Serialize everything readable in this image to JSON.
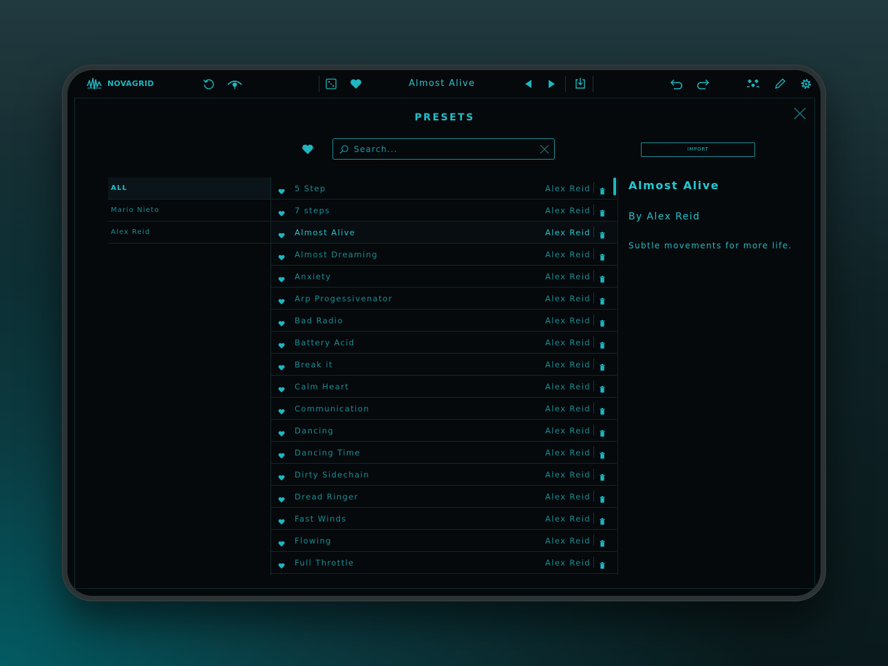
{
  "colors": {
    "accent": "#1fb6c0",
    "background": "#05090b",
    "frame": "#2c3335"
  },
  "topbar": {
    "logo_text": "NOVAGRID",
    "current_preset": "Almost Alive",
    "icons": [
      "logo-icon",
      "reset-icon",
      "preview-icon",
      "randomize-icon",
      "favorite-icon",
      "previous-icon",
      "next-icon",
      "save-icon",
      "undo-icon",
      "redo-icon",
      "modules-icon",
      "edit-icon",
      "settings-icon"
    ]
  },
  "presets_panel": {
    "title": "PRESETS",
    "search_placeholder": "Search...",
    "search_value": "",
    "import_label": "IMPORT",
    "authors": [
      {
        "label": "ALL",
        "active": true
      },
      {
        "label": "Mario Nieto",
        "active": false
      },
      {
        "label": "Alex Reid",
        "active": false
      }
    ],
    "presets": [
      {
        "name": "5 Step",
        "author": "Alex Reid"
      },
      {
        "name": "7 steps",
        "author": "Alex Reid"
      },
      {
        "name": "Almost Alive",
        "author": "Alex Reid",
        "active": true
      },
      {
        "name": "Almost Dreaming",
        "author": "Alex Reid"
      },
      {
        "name": "Anxiety",
        "author": "Alex Reid"
      },
      {
        "name": "Arp Progessivenator",
        "author": "Alex Reid"
      },
      {
        "name": "Bad Radio",
        "author": "Alex Reid"
      },
      {
        "name": "Battery Acid",
        "author": "Alex Reid"
      },
      {
        "name": "Break it",
        "author": "Alex Reid"
      },
      {
        "name": "Calm Heart",
        "author": "Alex Reid"
      },
      {
        "name": "Communication",
        "author": "Alex Reid"
      },
      {
        "name": "Dancing",
        "author": "Alex Reid"
      },
      {
        "name": "Dancing Time",
        "author": "Alex Reid"
      },
      {
        "name": "Dirty Sidechain",
        "author": "Alex Reid"
      },
      {
        "name": "Dread Ringer",
        "author": "Alex Reid"
      },
      {
        "name": "Fast Winds",
        "author": "Alex Reid"
      },
      {
        "name": "Flowing",
        "author": "Alex Reid"
      },
      {
        "name": "Full Throttle",
        "author": "Alex Reid"
      }
    ],
    "detail": {
      "title": "Almost Alive",
      "author_line": "By Alex Reid",
      "description": "Subtle movements for more life."
    }
  }
}
